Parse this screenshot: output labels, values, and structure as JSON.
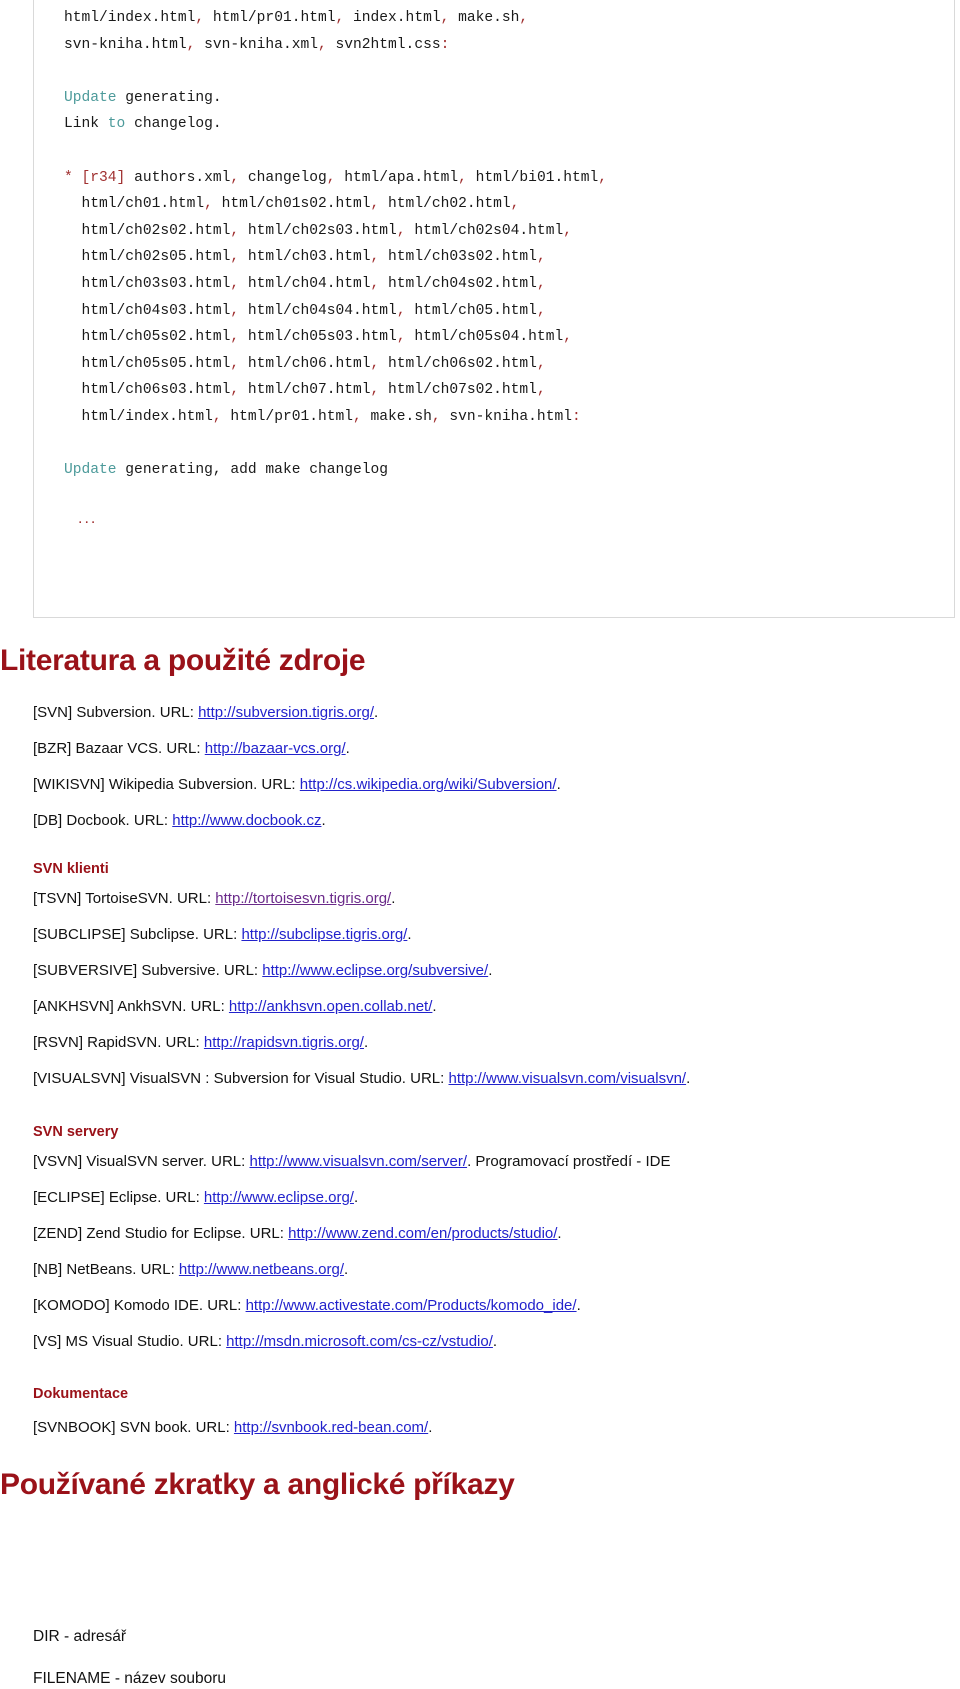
{
  "code_block": {
    "lines": [
      [
        {
          "t": "html/index.html",
          "c": "plain"
        },
        {
          "t": ", ",
          "c": "red"
        },
        {
          "t": "html/pr01.html",
          "c": "plain"
        },
        {
          "t": ", ",
          "c": "red"
        },
        {
          "t": "index.html",
          "c": "plain"
        },
        {
          "t": ", ",
          "c": "red"
        },
        {
          "t": "make.sh",
          "c": "plain"
        },
        {
          "t": ",",
          "c": "red"
        }
      ],
      [
        {
          "t": "svn-kniha.html",
          "c": "plain"
        },
        {
          "t": ", ",
          "c": "red"
        },
        {
          "t": "svn-kniha.xml",
          "c": "plain"
        },
        {
          "t": ", ",
          "c": "red"
        },
        {
          "t": "svn2html.css",
          "c": "plain"
        },
        {
          "t": ":",
          "c": "red"
        }
      ],
      [],
      [
        {
          "t": "Update",
          "c": "teal"
        },
        {
          "t": " generating.",
          "c": "plain"
        }
      ],
      [
        {
          "t": "Link ",
          "c": "plain"
        },
        {
          "t": "to",
          "c": "teal"
        },
        {
          "t": " changelog.",
          "c": "plain"
        }
      ],
      [],
      [
        {
          "t": "* ",
          "c": "red"
        },
        {
          "t": "[r34]",
          "c": "red"
        },
        {
          "t": " authors.xml",
          "c": "plain"
        },
        {
          "t": ", ",
          "c": "red"
        },
        {
          "t": "changelog",
          "c": "plain"
        },
        {
          "t": ", ",
          "c": "red"
        },
        {
          "t": "html/apa.html",
          "c": "plain"
        },
        {
          "t": ", ",
          "c": "red"
        },
        {
          "t": "html/bi01.html",
          "c": "plain"
        },
        {
          "t": ",",
          "c": "red"
        }
      ],
      [
        {
          "t": "  html/ch01.html",
          "c": "plain"
        },
        {
          "t": ", ",
          "c": "red"
        },
        {
          "t": "html/ch01s02.html",
          "c": "plain"
        },
        {
          "t": ", ",
          "c": "red"
        },
        {
          "t": "html/ch02.html",
          "c": "plain"
        },
        {
          "t": ",",
          "c": "red"
        }
      ],
      [
        {
          "t": "  html/ch02s02.html",
          "c": "plain"
        },
        {
          "t": ", ",
          "c": "red"
        },
        {
          "t": "html/ch02s03.html",
          "c": "plain"
        },
        {
          "t": ", ",
          "c": "red"
        },
        {
          "t": "html/ch02s04.html",
          "c": "plain"
        },
        {
          "t": ",",
          "c": "red"
        }
      ],
      [
        {
          "t": "  html/ch02s05.html",
          "c": "plain"
        },
        {
          "t": ", ",
          "c": "red"
        },
        {
          "t": "html/ch03.html",
          "c": "plain"
        },
        {
          "t": ", ",
          "c": "red"
        },
        {
          "t": "html/ch03s02.html",
          "c": "plain"
        },
        {
          "t": ",",
          "c": "red"
        }
      ],
      [
        {
          "t": "  html/ch03s03.html",
          "c": "plain"
        },
        {
          "t": ", ",
          "c": "red"
        },
        {
          "t": "html/ch04.html",
          "c": "plain"
        },
        {
          "t": ", ",
          "c": "red"
        },
        {
          "t": "html/ch04s02.html",
          "c": "plain"
        },
        {
          "t": ",",
          "c": "red"
        }
      ],
      [
        {
          "t": "  html/ch04s03.html",
          "c": "plain"
        },
        {
          "t": ", ",
          "c": "red"
        },
        {
          "t": "html/ch04s04.html",
          "c": "plain"
        },
        {
          "t": ", ",
          "c": "red"
        },
        {
          "t": "html/ch05.html",
          "c": "plain"
        },
        {
          "t": ",",
          "c": "red"
        }
      ],
      [
        {
          "t": "  html/ch05s02.html",
          "c": "plain"
        },
        {
          "t": ", ",
          "c": "red"
        },
        {
          "t": "html/ch05s03.html",
          "c": "plain"
        },
        {
          "t": ", ",
          "c": "red"
        },
        {
          "t": "html/ch05s04.html",
          "c": "plain"
        },
        {
          "t": ",",
          "c": "red"
        }
      ],
      [
        {
          "t": "  html/ch05s05.html",
          "c": "plain"
        },
        {
          "t": ", ",
          "c": "red"
        },
        {
          "t": "html/ch06.html",
          "c": "plain"
        },
        {
          "t": ", ",
          "c": "red"
        },
        {
          "t": "html/ch06s02.html",
          "c": "plain"
        },
        {
          "t": ",",
          "c": "red"
        }
      ],
      [
        {
          "t": "  html/ch06s03.html",
          "c": "plain"
        },
        {
          "t": ", ",
          "c": "red"
        },
        {
          "t": "html/ch07.html",
          "c": "plain"
        },
        {
          "t": ", ",
          "c": "red"
        },
        {
          "t": "html/ch07s02.html",
          "c": "plain"
        },
        {
          "t": ",",
          "c": "red"
        }
      ],
      [
        {
          "t": "  html/index.html",
          "c": "plain"
        },
        {
          "t": ", ",
          "c": "red"
        },
        {
          "t": "html/pr01.html",
          "c": "plain"
        },
        {
          "t": ", ",
          "c": "red"
        },
        {
          "t": "make.sh",
          "c": "plain"
        },
        {
          "t": ", ",
          "c": "red"
        },
        {
          "t": "svn-kniha.html",
          "c": "plain"
        },
        {
          "t": ":",
          "c": "red"
        }
      ],
      [],
      [
        {
          "t": "Update",
          "c": "teal"
        },
        {
          "t": " generating, add make changelog",
          "c": "plain"
        }
      ],
      [],
      [
        {
          "t": "",
          "c": "plain"
        }
      ]
    ],
    "ellipsis": "..."
  },
  "heading_literature": "Literatura a použité zdroje",
  "heading_abbreviations": "Používané zkratky a anglické příkazy",
  "subheading_clients": "SVN klienti",
  "subheading_servers": "SVN servery",
  "subheading_documentation": "Dokumentace",
  "bibliography": {
    "general": [
      {
        "tag": "[SVN]",
        "title": " Subversion. URL: ",
        "url": "http://subversion.tigris.org/",
        "suffix": ".",
        "visited": false
      },
      {
        "tag": "[BZR]",
        "title": " Bazaar VCS. URL: ",
        "url": "http://bazaar-vcs.org/",
        "suffix": ".",
        "visited": false
      },
      {
        "tag": "[WIKISVN]",
        "title": " Wikipedia Subversion. URL: ",
        "url": "http://cs.wikipedia.org/wiki/Subversion/",
        "suffix": ".",
        "visited": false
      },
      {
        "tag": "[DB]",
        "title": " Docbook. URL: ",
        "url": "http://www.docbook.cz",
        "suffix": ".",
        "visited": false
      }
    ],
    "clients": [
      {
        "tag": "[TSVN]",
        "title": " TortoiseSVN. URL: ",
        "url": "http://tortoisesvn.tigris.org/",
        "suffix": ".",
        "visited": true
      },
      {
        "tag": "[SUBCLIPSE]",
        "title": " Subclipse. URL: ",
        "url": "http://subclipse.tigris.org/",
        "suffix": ".",
        "visited": false
      },
      {
        "tag": "[SUBVERSIVE]",
        "title": " Subversive. URL: ",
        "url": "http://www.eclipse.org/subversive/",
        "suffix": ".",
        "visited": false
      },
      {
        "tag": "[ANKHSVN]",
        "title": " AnkhSVN. URL: ",
        "url": "http://ankhsvn.open.collab.net/",
        "suffix": ".",
        "visited": false
      },
      {
        "tag": "[RSVN]",
        "title": " RapidSVN. URL: ",
        "url": "http://rapidsvn.tigris.org/",
        "suffix": ".",
        "visited": false
      },
      {
        "tag": "[VISUALSVN]",
        "title": " VisualSVN : Subversion for Visual Studio. URL: ",
        "url": "http://www.visualsvn.com/visualsvn/",
        "suffix": ".",
        "visited": false
      }
    ],
    "servers": [
      {
        "tag": "[VSVN]",
        "title": " VisualSVN server. URL: ",
        "url": "http://www.visualsvn.com/server/",
        "suffix": ". Programovací prostředí - IDE",
        "visited": false
      },
      {
        "tag": "[ECLIPSE]",
        "title": " Eclipse. URL: ",
        "url": "http://www.eclipse.org/",
        "suffix": ".",
        "visited": false
      },
      {
        "tag": "[ZEND]",
        "title": " Zend Studio for Eclipse. URL: ",
        "url": "http://www.zend.com/en/products/studio/",
        "suffix": ".",
        "visited": false
      },
      {
        "tag": "[NB]",
        "title": " NetBeans. URL: ",
        "url": "http://www.netbeans.org/",
        "suffix": ".",
        "visited": false
      },
      {
        "tag": "[KOMODO]",
        "title": " Komodo IDE. URL: ",
        "url": "http://www.activestate.com/Products/komodo_ide/",
        "suffix": ".",
        "visited": false
      },
      {
        "tag": "[VS]",
        "title": " MS Visual Studio. URL: ",
        "url": "http://msdn.microsoft.com/cs-cz/vstudio/",
        "suffix": ".",
        "visited": false
      }
    ],
    "documentation": [
      {
        "tag": "[SVNBOOK]",
        "title": " SVN book. URL: ",
        "url": "http://svnbook.red-bean.com/",
        "suffix": ".",
        "visited": false
      }
    ]
  },
  "abbreviations": [
    "DIR - adresář",
    "FILENAME - název souboru"
  ],
  "colors": {
    "heading": "#9a1219",
    "link": "#2222cc",
    "link_visited": "#6a2a8a",
    "code_red": "#a03030",
    "code_teal": "#4c9a9a",
    "code_border": "#d9d9d9"
  }
}
